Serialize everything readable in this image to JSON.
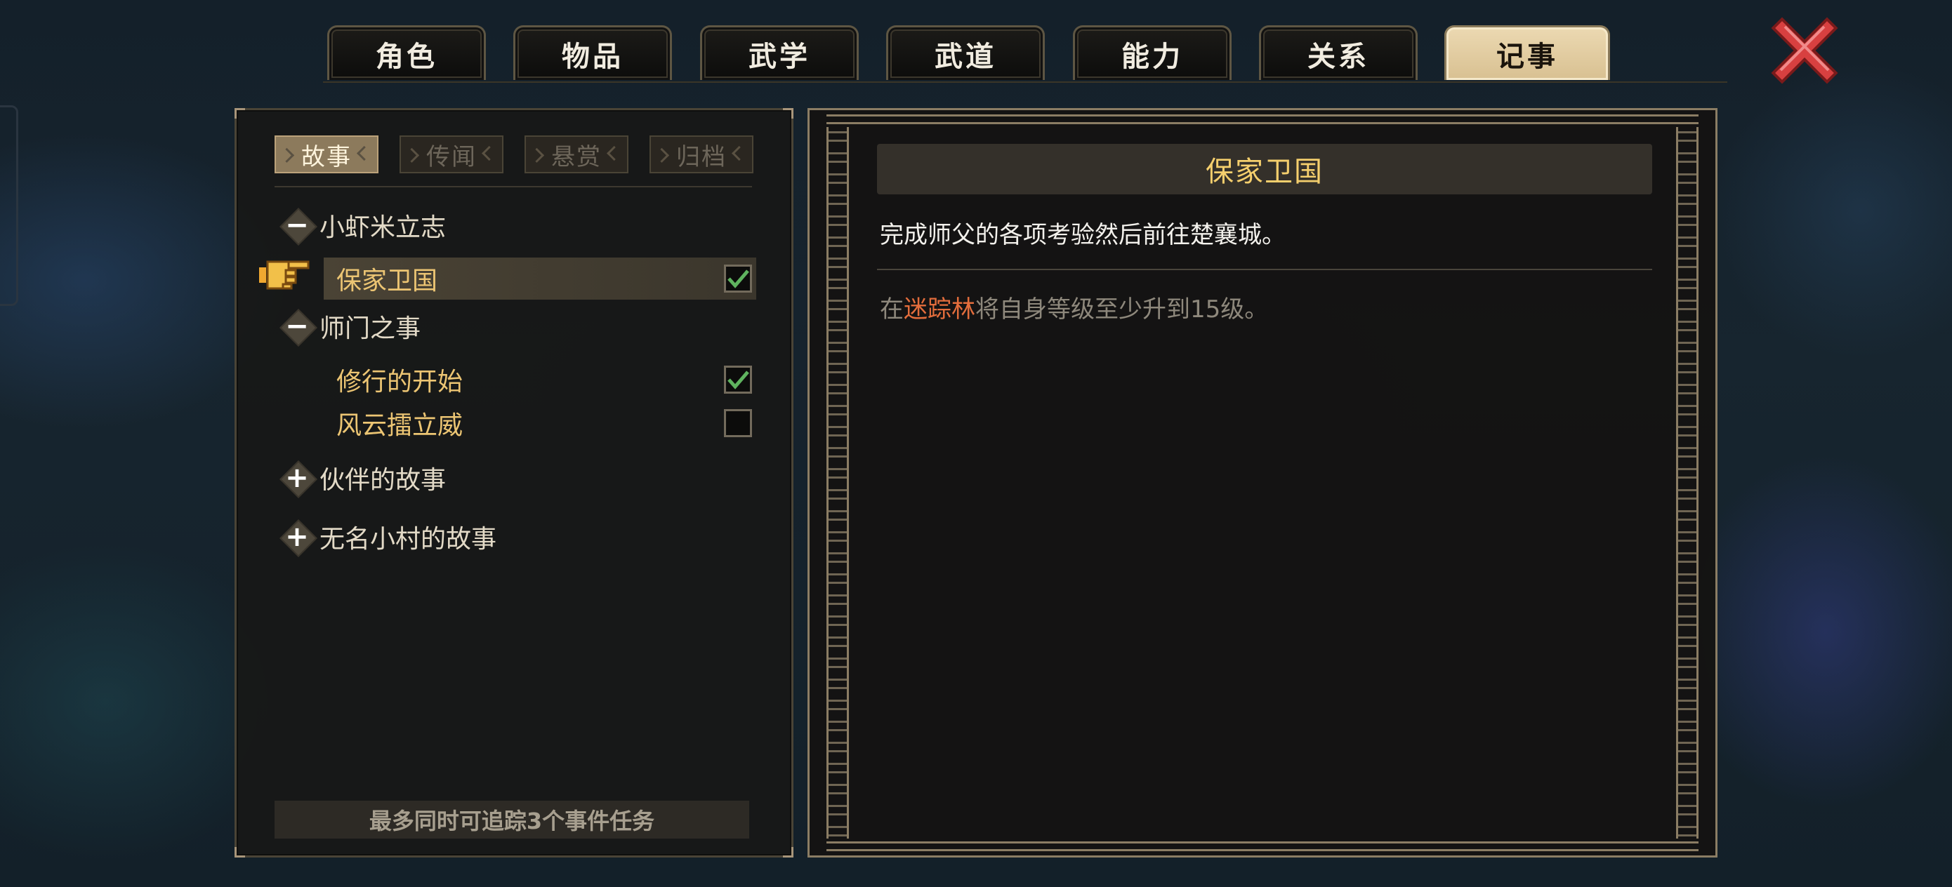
{
  "main_tabs": [
    {
      "label": "角色",
      "active": false
    },
    {
      "label": "物品",
      "active": false
    },
    {
      "label": "武学",
      "active": false
    },
    {
      "label": "武道",
      "active": false
    },
    {
      "label": "能力",
      "active": false
    },
    {
      "label": "关系",
      "active": false
    },
    {
      "label": "记事",
      "active": true
    }
  ],
  "close_icon": "close-x-icon",
  "sub_tabs": [
    {
      "label": "故事",
      "active": true
    },
    {
      "label": "传闻",
      "active": false
    },
    {
      "label": "悬赏",
      "active": false
    },
    {
      "label": "归档",
      "active": false
    }
  ],
  "groups": [
    {
      "label": "小虾米立志",
      "expanded": true,
      "toggle": "−",
      "quests": [
        {
          "label": "保家卫国",
          "completed": true,
          "selected": true
        }
      ]
    },
    {
      "label": "师门之事",
      "expanded": true,
      "toggle": "−",
      "quests": [
        {
          "label": "修行的开始",
          "completed": true,
          "selected": false
        },
        {
          "label": "风云擂立威",
          "completed": false,
          "selected": false
        }
      ]
    },
    {
      "label": "伙伴的故事",
      "expanded": false,
      "toggle": "+"
    },
    {
      "label": "无名小村的故事",
      "expanded": false,
      "toggle": "+"
    }
  ],
  "track_limit_text": "最多同时可追踪3个事件任务",
  "detail": {
    "title": "保家卫国",
    "description": "完成师父的各项考验然后前往楚襄城。",
    "objective_prefix": "在",
    "objective_location": "迷踪林",
    "objective_suffix": "将自身等级至少升到15级。"
  },
  "colors": {
    "gold_text": "#ecc573",
    "title_gold": "#f5cf6d",
    "location_orange": "#e36d3c",
    "check_green": "#5fb35f",
    "active_tab_bg": "#e3cfa4"
  }
}
